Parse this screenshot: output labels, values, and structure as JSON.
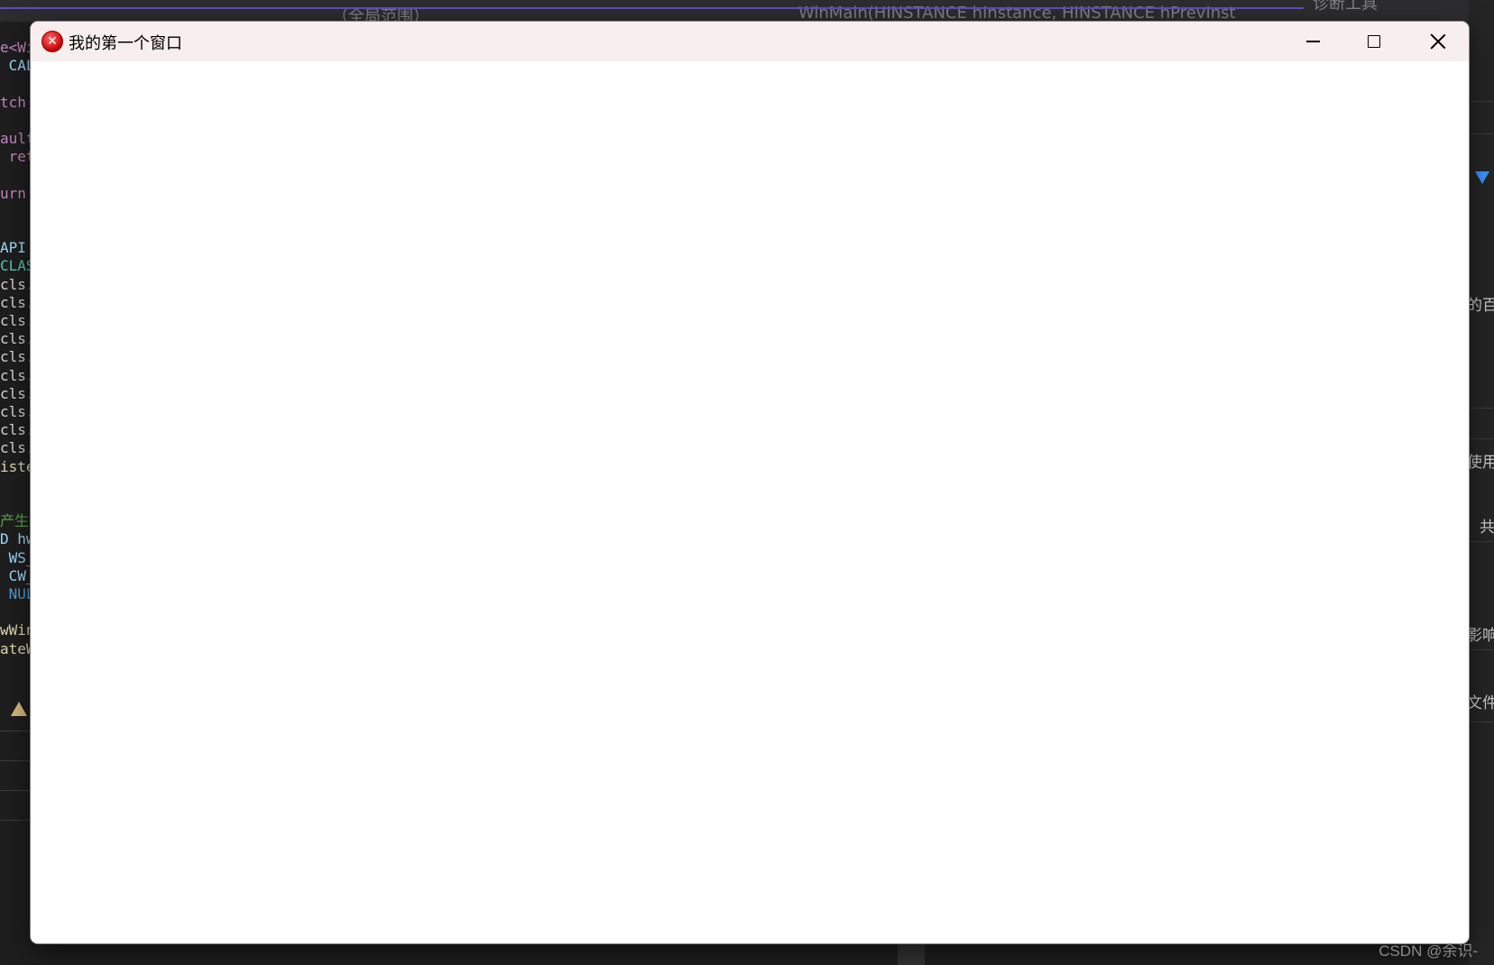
{
  "window": {
    "title": "我的第一个窗口"
  },
  "background": {
    "code_lines": [
      {
        "text": "e<Wi",
        "color": "#c586c0"
      },
      {
        "text": " CAL",
        "color": "#9cdcfe"
      },
      {
        "text": "",
        "color": "#d4d4d4"
      },
      {
        "text": "tch",
        "color": "#c586c0"
      },
      {
        "text": "",
        "color": "#d4d4d4"
      },
      {
        "text": "ault",
        "color": "#c586c0"
      },
      {
        "text": " ret",
        "color": "#c586c0"
      },
      {
        "text": "",
        "color": "#d4d4d4"
      },
      {
        "text": "urn",
        "color": "#c586c0"
      },
      {
        "text": "",
        "color": "#d4d4d4"
      },
      {
        "text": "",
        "color": "#d4d4d4"
      },
      {
        "text": "API",
        "color": "#9cdcfe"
      },
      {
        "text": "CLAS",
        "color": "#4ec9b0"
      },
      {
        "text": "cls.",
        "color": "#d4d4d4"
      },
      {
        "text": "cls.",
        "color": "#d4d4d4"
      },
      {
        "text": "cls.",
        "color": "#d4d4d4"
      },
      {
        "text": "cls.",
        "color": "#d4d4d4"
      },
      {
        "text": "cls.",
        "color": "#d4d4d4"
      },
      {
        "text": "cls.",
        "color": "#d4d4d4"
      },
      {
        "text": "cls.",
        "color": "#d4d4d4"
      },
      {
        "text": "cls.",
        "color": "#d4d4d4"
      },
      {
        "text": "cls.",
        "color": "#d4d4d4"
      },
      {
        "text": "cls.",
        "color": "#d4d4d4"
      },
      {
        "text": "iste",
        "color": "#dcdcaa"
      },
      {
        "text": "",
        "color": "#d4d4d4"
      },
      {
        "text": "",
        "color": "#d4d4d4"
      },
      {
        "text": "产生一",
        "color": "#57a64a"
      },
      {
        "text": "D hw",
        "color": "#9cdcfe"
      },
      {
        "text": " WS_",
        "color": "#9cdcfe"
      },
      {
        "text": " CW_",
        "color": "#9cdcfe"
      },
      {
        "text": " NUL",
        "color": "#569cd6"
      },
      {
        "text": "",
        "color": "#d4d4d4"
      },
      {
        "text": "wWin",
        "color": "#dcdcaa"
      },
      {
        "text": "ateW",
        "color": "#dcdcaa"
      }
    ],
    "top_faded_1": "（全局范围）",
    "top_faded_2": "WinMain(HINSTANCE hInstance, HINSTANCE hPrevInst",
    "top_faded_3": "诊断工具",
    "right_texts": [
      "的百",
      "使用",
      "共",
      "影响",
      "文件"
    ],
    "watermark": "CSDN @余识-"
  }
}
